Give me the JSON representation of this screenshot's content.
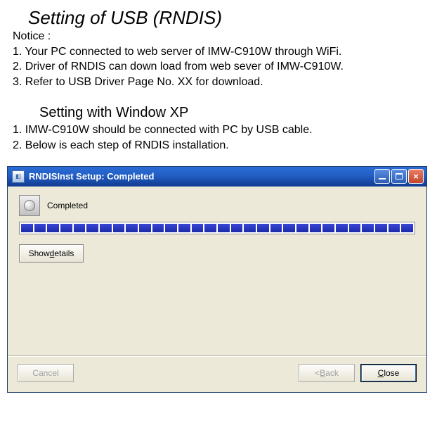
{
  "doc": {
    "title": "Setting  of  USB  (RNDIS)",
    "notice_label": "Notice :",
    "notice_items": [
      "1. Your PC connected to web server of IMW-C910W through WiFi.",
      "2. Driver of RNDIS can down load from web sever of IMW-C910W.",
      "3. Refer to USB Driver Page No. XX for download."
    ],
    "subtitle": "Setting  with  Window  XP",
    "steps": [
      "1. IMW-C910W should be connected with PC by USB cable.",
      "2. Below is each step of RNDIS installation."
    ]
  },
  "installer": {
    "title": "RNDISInst Setup: Completed",
    "status": "Completed",
    "buttons": {
      "show_details": "Show details",
      "show_details_uchar": "d",
      "cancel": "Cancel",
      "back": "< Back",
      "back_uchar": "B",
      "close": "Close",
      "close_uchar": "C"
    }
  }
}
